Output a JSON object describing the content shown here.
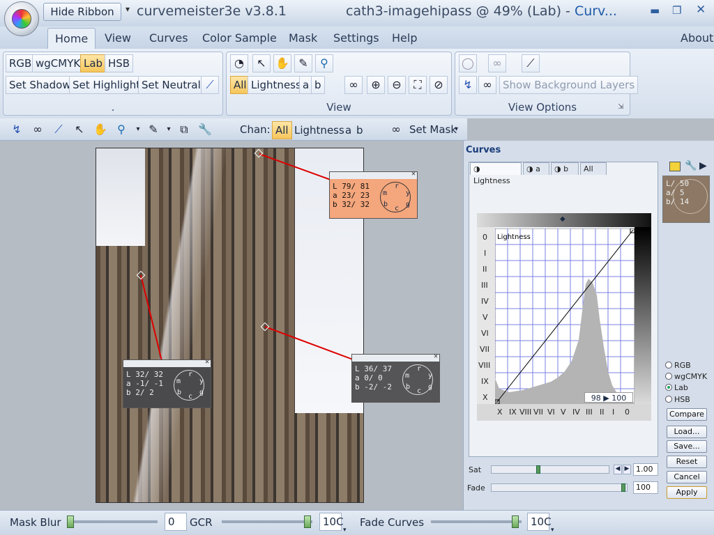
{
  "titlebar": {
    "hide_ribbon": "Hide Ribbon",
    "app_title": "curvemeister3e v3.8.1",
    "doc_title": "cath3-imagehipass @ 49% (Lab) - ",
    "doc_title_accent": "Curv..."
  },
  "menu": {
    "tabs": [
      "Home",
      "View",
      "Curves",
      "Color Sample",
      "Mask",
      "Settings",
      "Help"
    ],
    "about": "About"
  },
  "ribbon": {
    "mode": {
      "buttons": [
        "RGB",
        "wgCMYK",
        "Lab",
        "HSB"
      ],
      "selected": "Lab",
      "set_shadow": "Set Shadow",
      "set_highlight": "Set Highlight",
      "set_neutral": "Set Neutral",
      "label": "."
    },
    "view": {
      "channels": [
        "All",
        "Lightness",
        "a",
        "b"
      ],
      "selected": "All",
      "label": "View"
    },
    "view_options": {
      "show_bg": "Show Background Layers",
      "label": "View Options"
    }
  },
  "toolbar": {
    "chan_label": "Chan:",
    "channels": [
      "All",
      "Lightness",
      "a",
      "b"
    ],
    "selected": "All",
    "set_mask": "Set Mask"
  },
  "samplers": [
    {
      "L": "79/ 81",
      "a": "23/ 23",
      "b": "32/ 32",
      "bg": "#f4a67c"
    },
    {
      "L": "32/ 32",
      "a": "-1/ -1",
      "b": "2/ 2",
      "bg": "#4a4a4c"
    },
    {
      "L": "36/ 37",
      "a": "0/ 0",
      "b": "-2/ -2",
      "bg": "#555558"
    }
  ],
  "dial_letters": {
    "r": "r",
    "y": "y",
    "g": "g",
    "c": "c",
    "b": "b",
    "m": "m"
  },
  "curves_panel": {
    "title": "Curves",
    "tabs": [
      "Lightness",
      "a",
      "b",
      "All"
    ],
    "selected_tab": "Lightness",
    "graph_label": "Lightness",
    "left_zones": [
      "0",
      "I",
      "II",
      "III",
      "IV",
      "V",
      "VI",
      "VII",
      "VIII",
      "IX",
      "X"
    ],
    "bottom_zones": [
      "X",
      "IX",
      "VIII",
      "VII",
      "VI",
      "V",
      "IV",
      "III",
      "II",
      "I",
      "0"
    ],
    "readout": "98 ▶ 100",
    "mini": {
      "L": "L/ 50",
      "a": "a/  5",
      "b": "b/ 14"
    },
    "color_spaces": [
      "RGB",
      "wgCMYK",
      "Lab",
      "HSB"
    ],
    "selected_space": "Lab",
    "buttons": {
      "compare": "Compare",
      "load": "Load...",
      "save": "Save...",
      "reset": "Reset",
      "cancel": "Cancel",
      "apply": "Apply"
    },
    "sat_label": "Sat",
    "sat_value": "1.00",
    "sat_level": 0.4,
    "fade_label": "Fade",
    "fade_value": "100",
    "fade_level": 1.0
  },
  "bottombar": {
    "mask_blur": "Mask Blur",
    "mask_blur_value": "0",
    "gcr": "GCR",
    "gcr_value": "10C",
    "fade_curves": "Fade Curves",
    "fade_curves_value": "10C"
  }
}
